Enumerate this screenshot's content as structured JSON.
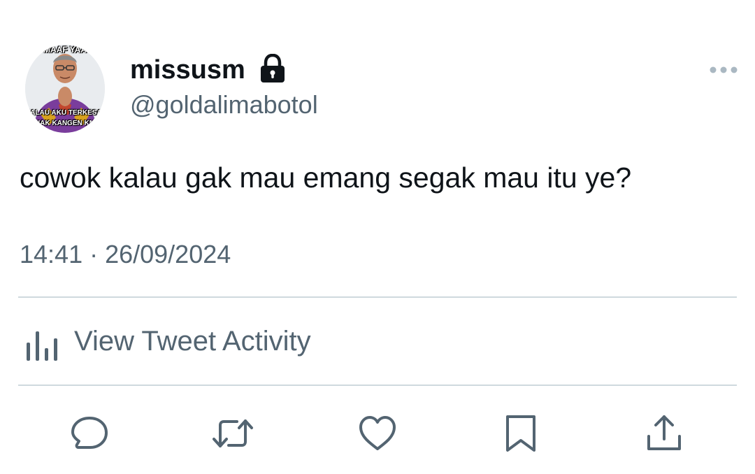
{
  "author": {
    "avatar_caption_top": "MAAF YAA",
    "avatar_caption_middle": "KALAU AKU TERKESAN",
    "avatar_caption_bottom": "NAK KANGEN KM",
    "display_name": "missusm",
    "handle": "@goldalimabotol",
    "protected_icon": "lock-icon"
  },
  "tweet": {
    "text": "cowok kalau gak mau emang segak mau itu ye?",
    "timestamp": "14:41 · 26/09/2024"
  },
  "activity": {
    "label": "View Tweet Activity",
    "icon": "bar-chart-icon"
  },
  "actions": [
    {
      "name": "reply",
      "icon": "reply-icon"
    },
    {
      "name": "retweet",
      "icon": "retweet-icon"
    },
    {
      "name": "like",
      "icon": "heart-icon"
    },
    {
      "name": "bookmark",
      "icon": "bookmark-icon"
    },
    {
      "name": "share",
      "icon": "share-icon"
    }
  ],
  "colors": {
    "primary_text": "#0f1419",
    "secondary_text": "#536471",
    "divider": "#cfd9de",
    "background": "#ffffff"
  }
}
